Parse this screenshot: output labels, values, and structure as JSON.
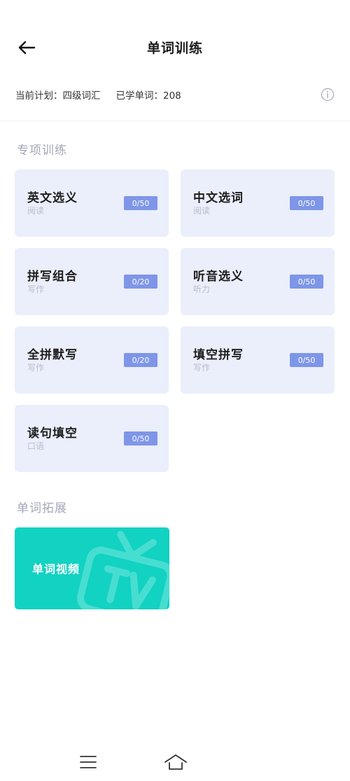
{
  "header": {
    "title": "单词训练",
    "back_icon": "arrow-left-icon"
  },
  "plan": {
    "current_plan_label": "当前计划：四级词汇",
    "learned_label": "已学单词：208",
    "info_icon": "info-icon"
  },
  "special_training": {
    "title": "专项训练",
    "cards": [
      {
        "name": "英文选义",
        "tag": "阅读",
        "progress": "0/50"
      },
      {
        "name": "中文选词",
        "tag": "阅读",
        "progress": "0/50"
      },
      {
        "name": "拼写组合",
        "tag": "写作",
        "progress": "0/20"
      },
      {
        "name": "听音选义",
        "tag": "听力",
        "progress": "0/50"
      },
      {
        "name": "全拼默写",
        "tag": "写作",
        "progress": "0/20"
      },
      {
        "name": "填空拼写",
        "tag": "写作",
        "progress": "0/50"
      },
      {
        "name": "读句填空",
        "tag": "口语",
        "progress": "0/50"
      }
    ]
  },
  "word_extension": {
    "title": "单词拓展",
    "video_card_label": "单词视频",
    "video_icon": "tv-icon"
  },
  "bottom_nav": {
    "menu_icon": "menu-icon",
    "home_icon": "home-icon"
  },
  "colors": {
    "card_bg": "#ebeefb",
    "badge_bg": "#7e96e8",
    "video_card_bg": "#12d2c2",
    "section_title": "#a3a8b8"
  }
}
